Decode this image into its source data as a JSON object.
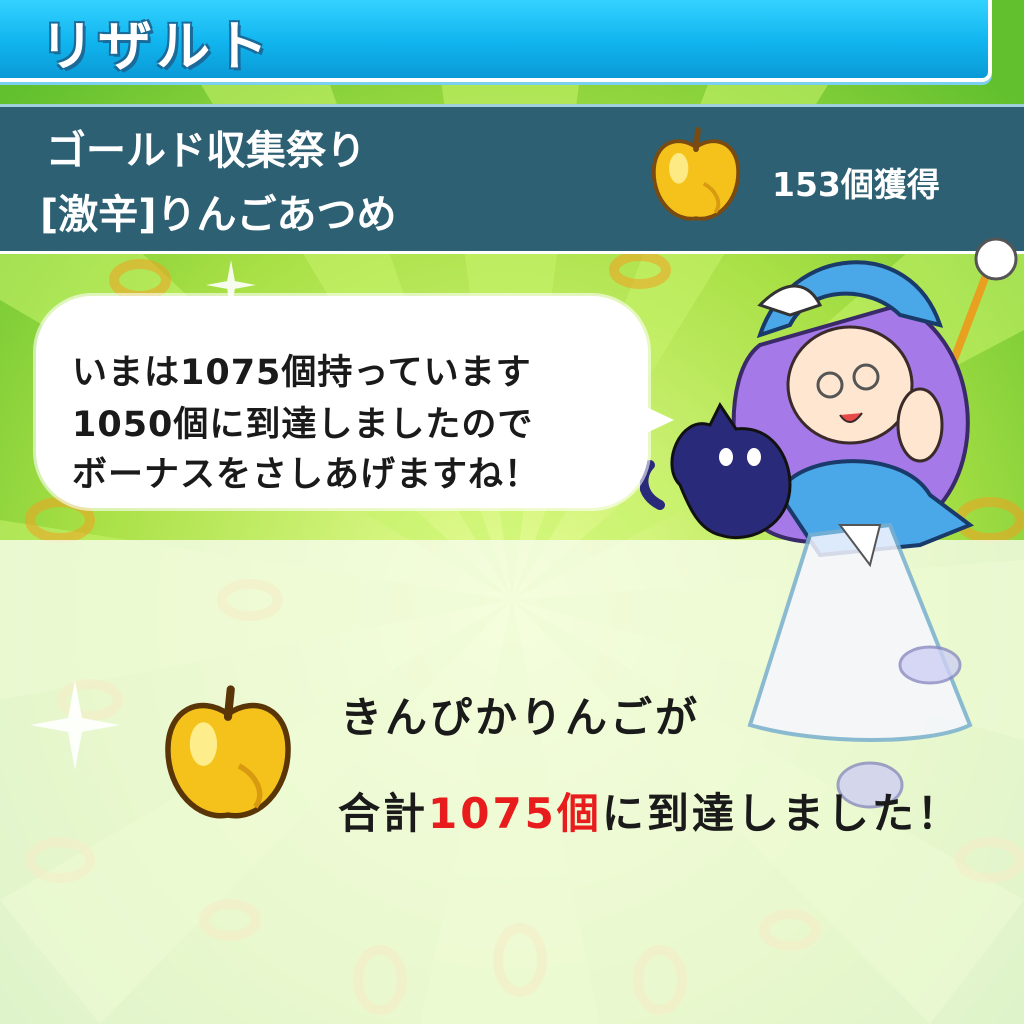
{
  "header": {
    "title": "リザルト"
  },
  "event": {
    "name": "ゴールド収集祭り",
    "subtitle": "[激辛]りんごあつめ",
    "earned_label": "153個獲得",
    "icon": "golden-apple-icon"
  },
  "dialogue": {
    "line1": "いまは1075個持っています",
    "line2": "1050個に到達しましたので",
    "line3": "ボーナスをさしあげますね！"
  },
  "result": {
    "line1": "きんぴかりんごが",
    "total_prefix": "合計",
    "total_value": "1075個",
    "total_suffix": "に到達しました！",
    "icon": "golden-apple-icon"
  },
  "colors": {
    "title_bar": "#10b4ee",
    "event_bar": "#2c6072",
    "highlight": "#e81c1c",
    "background": "#9fe04a"
  }
}
